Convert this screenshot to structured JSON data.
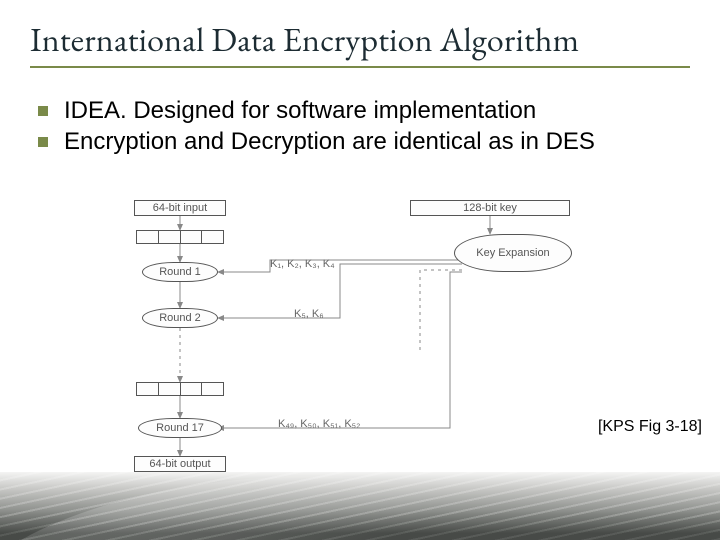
{
  "title": "International Data Encryption Algorithm",
  "bullets": [
    "IDEA. Designed for software implementation",
    "Encryption and Decryption are identical as in DES"
  ],
  "citation": "[KPS Fig 3-18]",
  "diagram": {
    "input_box": "64-bit input",
    "key_box": "128-bit key",
    "key_expansion": "Key Expansion",
    "round1": "Round 1",
    "round2": "Round 2",
    "round17": "Round 17",
    "keys_r1": "K₁, K₂, K₃, K₄",
    "keys_r2": "K₅, K₆",
    "keys_r17": "K₄₉, K₅₀, K₅₁, K₅₂",
    "output_box": "64-bit output"
  }
}
